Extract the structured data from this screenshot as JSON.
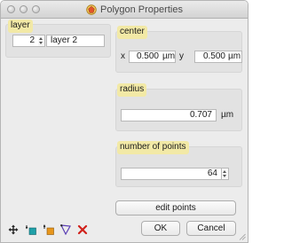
{
  "window": {
    "title": "Polygon Properties",
    "app_icon": "polygon-app-icon"
  },
  "layer": {
    "label": "layer",
    "number_value": "2",
    "name_value": "layer 2"
  },
  "center": {
    "label": "center",
    "x_label": "x",
    "x_value": "0.500",
    "x_unit": "µm",
    "y_label": "y",
    "y_value": "0.500",
    "y_unit": "µm"
  },
  "radius": {
    "label": "radius",
    "value": "0.707",
    "unit": "µm"
  },
  "points": {
    "label": "number of points",
    "value": "64"
  },
  "buttons": {
    "edit_points": "edit points",
    "ok": "OK",
    "cancel": "Cancel"
  },
  "toolbar": {
    "icons": [
      "move-icon",
      "layer-down-icon",
      "layer-up-icon",
      "select-icon",
      "delete-icon"
    ]
  },
  "colors": {
    "label_highlight": "#f2e9a6",
    "group_bg": "#e2e2e2",
    "delete_red": "#d0201a",
    "accent_green": "#2e9c3e",
    "accent_teal": "#1fa0a8",
    "accent_orange": "#e7961c",
    "accent_purple": "#5b3fb5"
  }
}
